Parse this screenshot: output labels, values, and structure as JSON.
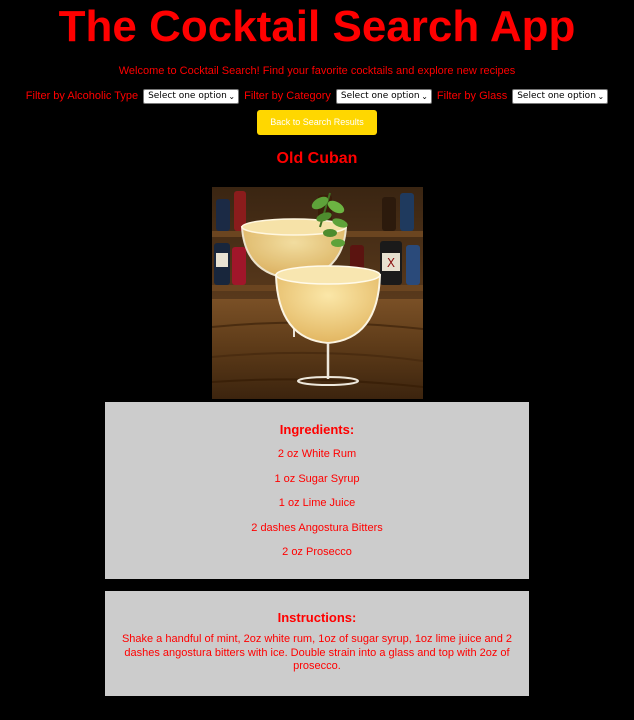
{
  "header": {
    "title": "The Cocktail Search App",
    "welcome": "Welcome to Cocktail Search! Find your favorite cocktails and explore new recipes"
  },
  "filters": [
    {
      "label": "Filter by Alcoholic Type",
      "selected": "Select one option"
    },
    {
      "label": "Filter by Category",
      "selected": "Select one option"
    },
    {
      "label": "Filter by Glass",
      "selected": "Select one option"
    }
  ],
  "back_button_label": "Back to Search Results",
  "drink": {
    "name": "Old Cuban",
    "photo_icon": "cocktail-photo",
    "ingredients_heading": "Ingredients:",
    "ingredients": [
      "2 oz White Rum",
      "1 oz Sugar Syrup",
      "1 oz Lime Juice",
      "2 dashes Angostura Bitters",
      "2 oz Prosecco"
    ],
    "instructions_heading": "Instructions:",
    "instructions": "Shake a handful of mint, 2oz white rum, 1oz of sugar syrup, 1oz lime juice and 2 dashes angostura bitters with ice. Double strain into a glass and top with 2oz of prosecco."
  },
  "colors": {
    "background": "#000000",
    "text": "#ff0000",
    "button": "#ffd700",
    "card": "#cccccc"
  }
}
